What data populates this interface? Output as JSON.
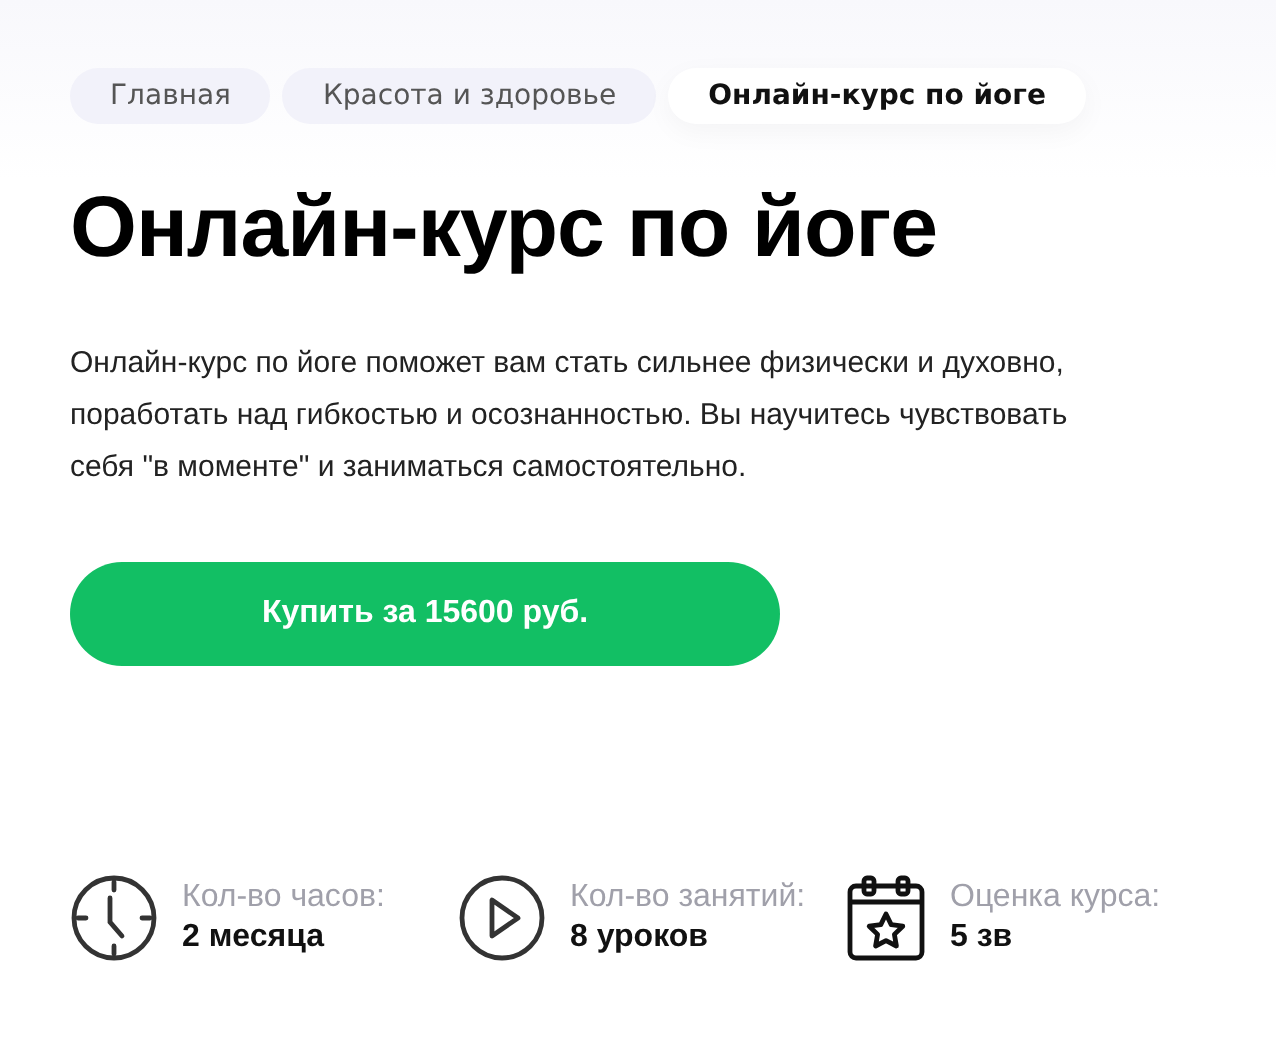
{
  "breadcrumbs": [
    {
      "label": "Главная",
      "selected": false
    },
    {
      "label": "Красота и здоровье",
      "selected": false
    },
    {
      "label": "Онлайн-курс по йоге",
      "selected": true
    }
  ],
  "title": "Онлайн-курс по йоге",
  "description": "Онлайн-курс по йоге поможет вам стать сильнее физически и духовно, поработать над гибкостью и осознанностью. Вы научитесь чувствовать себя \"в моменте\" и заниматься самостоятельно.",
  "buy_button": "Купить за 15600 руб.",
  "stats": [
    {
      "kind": "clock",
      "label": "Кол-во часов:",
      "value": "2 месяца"
    },
    {
      "kind": "play",
      "label": "Кол-во занятий:",
      "value": "8 уроков"
    },
    {
      "kind": "calendar",
      "label": "Оценка курса:",
      "value": "5 зв"
    }
  ]
}
